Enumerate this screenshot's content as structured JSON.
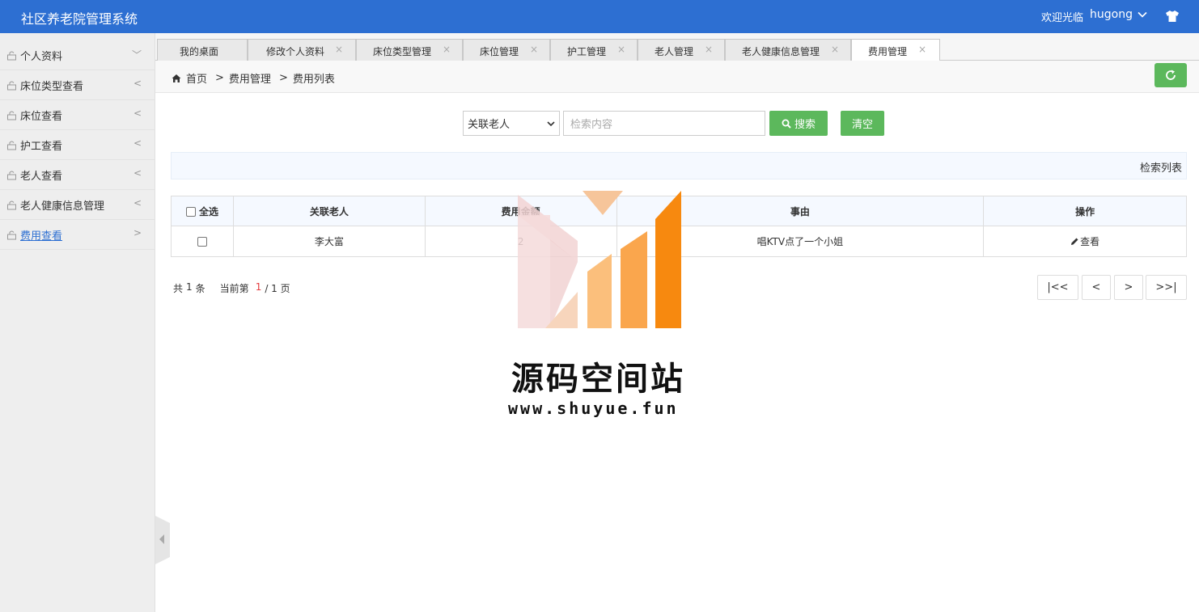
{
  "header": {
    "title": "社区养老院管理系统",
    "welcome": "欢迎光临",
    "username": "hugong",
    "bg_color": "#2d6fd2"
  },
  "sidebar": {
    "items": [
      {
        "label": "个人资料",
        "arrow": "﹀"
      },
      {
        "label": "床位类型查看",
        "arrow": "<"
      },
      {
        "label": "床位查看",
        "arrow": "<"
      },
      {
        "label": "护工查看",
        "arrow": "<"
      },
      {
        "label": "老人查看",
        "arrow": "<"
      },
      {
        "label": "老人健康信息管理",
        "arrow": "<"
      },
      {
        "label": "费用查看",
        "arrow": ">"
      }
    ]
  },
  "tabs": [
    {
      "label": "我的桌面"
    },
    {
      "label": "修改个人资料",
      "close": "×"
    },
    {
      "label": "床位类型管理",
      "close": "×"
    },
    {
      "label": "床位管理",
      "close": "×"
    },
    {
      "label": "护工管理",
      "close": "×"
    },
    {
      "label": "老人管理",
      "close": "×"
    },
    {
      "label": "老人健康信息管理",
      "close": "×"
    },
    {
      "label": "费用管理",
      "close": "×"
    }
  ],
  "breadcrumb": {
    "home": "首页",
    "sep": ">",
    "level1": "费用管理",
    "level2": "费用列表"
  },
  "search": {
    "select_value": "关联老人",
    "placeholder": "检索内容",
    "search_label": "搜索",
    "clear_label": "清空"
  },
  "list_title": "检索列表",
  "table": {
    "headers": {
      "select_all": "全选",
      "elder": "关联老人",
      "fee": "费用金额",
      "reason": "事由",
      "action": "操作"
    },
    "rows": [
      {
        "elder": "李大富",
        "fee": "2",
        "reason": "唱KTV点了一个小姐",
        "action": "查看"
      }
    ]
  },
  "pagination": {
    "total_prefix": "共",
    "total": "1",
    "total_suffix": "条",
    "current_prefix": "当前第",
    "current": "1",
    "of": "/ 1 页",
    "first": "|<<",
    "prev": "<",
    "next": ">",
    "last": ">>|"
  },
  "watermark": {
    "title": "源码空间站",
    "url": "www.shuyue.fun"
  }
}
